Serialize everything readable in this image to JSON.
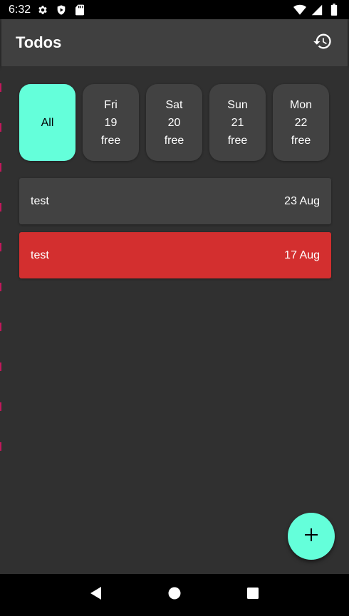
{
  "status_bar": {
    "time": "6:32",
    "left_icons": [
      "settings-icon",
      "shield-icon",
      "sd-card-icon"
    ],
    "right_icons": [
      "wifi-icon",
      "signal-icon",
      "battery-icon"
    ]
  },
  "app_bar": {
    "title": "Todos",
    "action_icon": "history-icon"
  },
  "day_filters": [
    {
      "label": "All",
      "selected": true
    },
    {
      "day": "Fri",
      "date": "19",
      "status": "free",
      "selected": false
    },
    {
      "day": "Sat",
      "date": "20",
      "status": "free",
      "selected": false
    },
    {
      "day": "Sun",
      "date": "21",
      "status": "free",
      "selected": false
    },
    {
      "day": "Mon",
      "date": "22",
      "status": "free",
      "selected": false
    }
  ],
  "todos": [
    {
      "title": "test",
      "date": "23 Aug",
      "color": "#424242"
    },
    {
      "title": "test",
      "date": "17 Aug",
      "color": "#d32f2f"
    }
  ],
  "fab": {
    "icon": "plus-icon"
  },
  "nav_bar": {
    "icons": [
      "back-icon",
      "home-icon",
      "recents-icon"
    ]
  },
  "colors": {
    "accent": "#64ffda",
    "background": "#303030",
    "app_bar": "#404040",
    "card": "#424242",
    "overdue": "#d32f2f"
  }
}
